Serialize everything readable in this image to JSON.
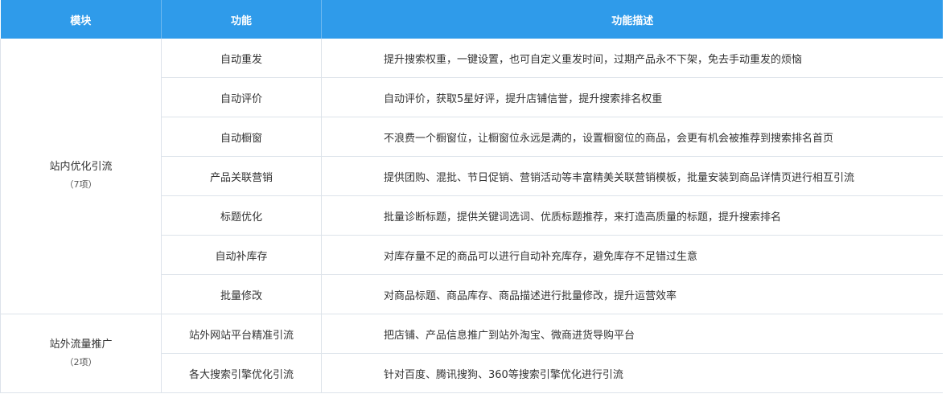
{
  "headers": {
    "module": "模块",
    "function": "功能",
    "description": "功能描述"
  },
  "groups": [
    {
      "name": "站内优化引流",
      "count": "（7项）",
      "rows": [
        {
          "function": "自动重发",
          "description": "提升搜索权重，一键设置，也可自定义重发时间，过期产品永不下架，免去手动重发的烦恼"
        },
        {
          "function": "自动评价",
          "description": "自动评价，获取5星好评，提升店铺信誉，提升搜索排名权重"
        },
        {
          "function": "自动橱窗",
          "description": "不浪费一个橱窗位，让橱窗位永远是满的，设置橱窗位的商品，会更有机会被推荐到搜索排名首页"
        },
        {
          "function": "产品关联营销",
          "description": "提供团购、混批、节日促销、营销活动等丰富精美关联营销模板，批量安装到商品详情页进行相互引流"
        },
        {
          "function": "标题优化",
          "description": "批量诊断标题，提供关键词选词、优质标题推荐，来打造高质量的标题，提升搜索排名"
        },
        {
          "function": "自动补库存",
          "description": "对库存量不足的商品可以进行自动补充库存，避免库存不足错过生意"
        },
        {
          "function": "批量修改",
          "description": "对商品标题、商品库存、商品描述进行批量修改，提升运营效率"
        }
      ]
    },
    {
      "name": "站外流量推广",
      "count": "（2项）",
      "rows": [
        {
          "function": "站外网站平台精准引流",
          "description": "把店铺、产品信息推广到站外淘宝、微商进货导购平台"
        },
        {
          "function": "各大搜索引擎优化引流",
          "description": "针对百度、腾讯搜狗、360等搜索引擎优化进行引流"
        }
      ]
    }
  ]
}
